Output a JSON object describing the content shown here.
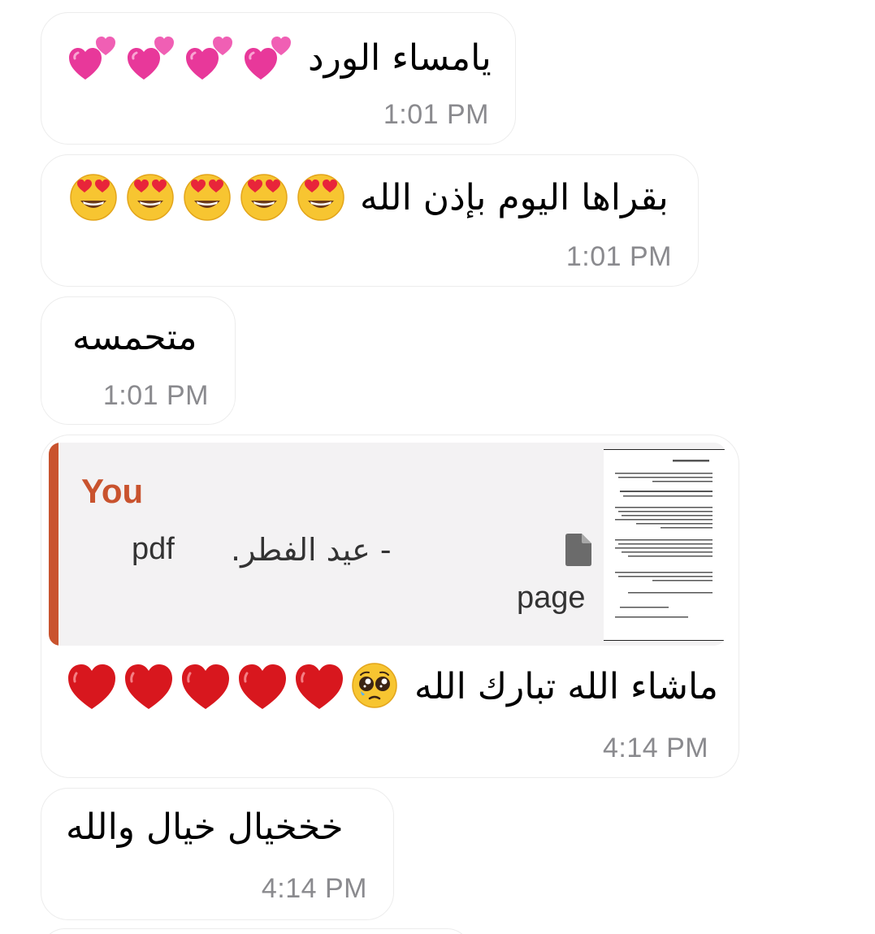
{
  "messages": [
    {
      "text": "يامساء الورد",
      "emoji": [
        "two-hearts",
        "two-hearts",
        "two-hearts",
        "two-hearts"
      ],
      "time": "1:01 PM"
    },
    {
      "text": "بقراها اليوم بإذن الله",
      "emoji": [
        "heart-eyes",
        "heart-eyes",
        "heart-eyes",
        "heart-eyes",
        "heart-eyes"
      ],
      "time": "1:01 PM"
    },
    {
      "text": "متحمسه",
      "time": "1:01 PM"
    },
    {
      "reply": {
        "author": "You",
        "file_ext": "pdf",
        "file_name": "- عيد الفطر.",
        "file_icon": "document-icon",
        "pages": "page"
      },
      "text": "ماشاء الله تبارك الله",
      "emoji": [
        "pleading-face",
        "red-heart",
        "red-heart",
        "red-heart",
        "red-heart",
        "red-heart"
      ],
      "time": "4:14 PM"
    },
    {
      "text": "خخخيال خيال والله",
      "time": "4:14 PM"
    }
  ],
  "colors": {
    "reply_accent": "#c9532e",
    "timestamp": "#8a8a8e",
    "bubble_border": "#ececec"
  }
}
